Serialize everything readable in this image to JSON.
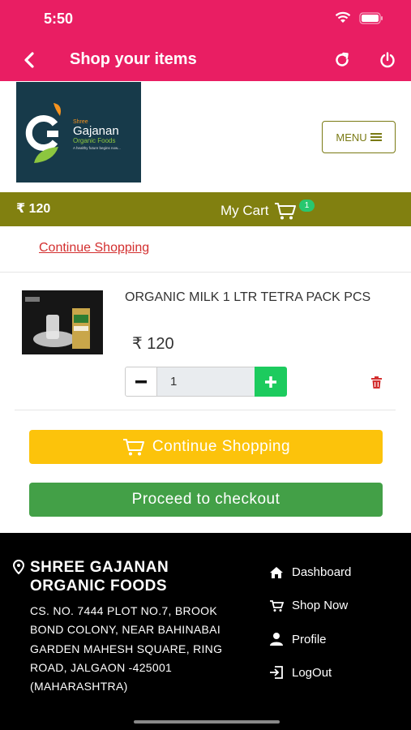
{
  "status_bar": {
    "time": "5:50"
  },
  "appbar": {
    "title": "Shop your items"
  },
  "logo": {
    "shree": "Shree",
    "name": "Gajanan",
    "sub": "Organic Foods",
    "tagline": "A healthy future begins now..."
  },
  "menu": {
    "label": "MENU"
  },
  "cart_bar": {
    "total": "₹ 120",
    "label": "My Cart",
    "count": "1"
  },
  "continue_link": "Continue Shopping",
  "cart_items": [
    {
      "name": "ORGANIC MILK 1 LTR TETRA PACK PCS",
      "price": "₹ 120",
      "quantity": "1"
    }
  ],
  "buttons": {
    "continue": "Continue Shopping",
    "checkout": "Proceed to checkout"
  },
  "footer": {
    "company": "SHREE GAJANAN ORGANIC FOODS",
    "address": "CS. NO. 7444 PLOT NO.7, BROOK BOND COLONY, NEAR BAHINABAI GARDEN MAHESH SQUARE, RING ROAD, JALGAON -425001 (MAHARASHTRA)",
    "links": [
      "Dashboard",
      "Shop Now",
      "Profile",
      "LogOut"
    ]
  },
  "colors": {
    "appbar": "#e91e63",
    "cart_bar": "#818010",
    "continue_button": "#fcc30b",
    "checkout_button": "#43a047",
    "plus_button": "#1ccb5e",
    "link": "#d32f2f"
  }
}
